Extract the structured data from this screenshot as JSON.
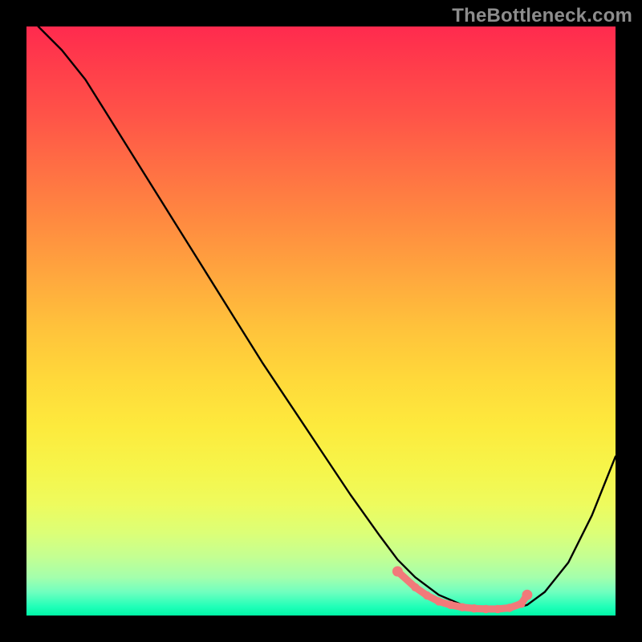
{
  "watermark": "TheBottleneck.com",
  "chart_data": {
    "type": "line",
    "title": "",
    "xlabel": "",
    "ylabel": "",
    "xlim": [
      0,
      100
    ],
    "ylim": [
      0,
      100
    ],
    "grid": false,
    "legend": false,
    "series": [
      {
        "name": "bottleneck-curve",
        "color": "#000000",
        "x": [
          2,
          6,
          10,
          15,
          20,
          25,
          30,
          35,
          40,
          45,
          50,
          55,
          60,
          63,
          66,
          70,
          74,
          78,
          82,
          85,
          88,
          92,
          96,
          100
        ],
        "y": [
          100,
          96,
          91,
          83,
          75,
          67,
          59,
          51,
          43,
          35.5,
          28,
          20.5,
          13.5,
          9.5,
          6.5,
          3.5,
          1.8,
          1.1,
          1.1,
          1.8,
          4,
          9,
          17,
          27
        ]
      },
      {
        "name": "optimal-range-marker",
        "color": "#f17a7a",
        "x": [
          63,
          66,
          68,
          70,
          72,
          74,
          76,
          78,
          80,
          82,
          84,
          85
        ],
        "y": [
          7.5,
          4.8,
          3.4,
          2.4,
          1.8,
          1.4,
          1.2,
          1.1,
          1.1,
          1.3,
          2.0,
          3.5
        ]
      }
    ],
    "background_gradient_stops": [
      {
        "pos": 0.0,
        "color": "#ff2a4e"
      },
      {
        "pos": 0.25,
        "color": "#ff7a42"
      },
      {
        "pos": 0.5,
        "color": "#ffc53b"
      },
      {
        "pos": 0.75,
        "color": "#f3f84f"
      },
      {
        "pos": 0.96,
        "color": "#70ffbf"
      },
      {
        "pos": 1.0,
        "color": "#00f8a7"
      }
    ]
  }
}
